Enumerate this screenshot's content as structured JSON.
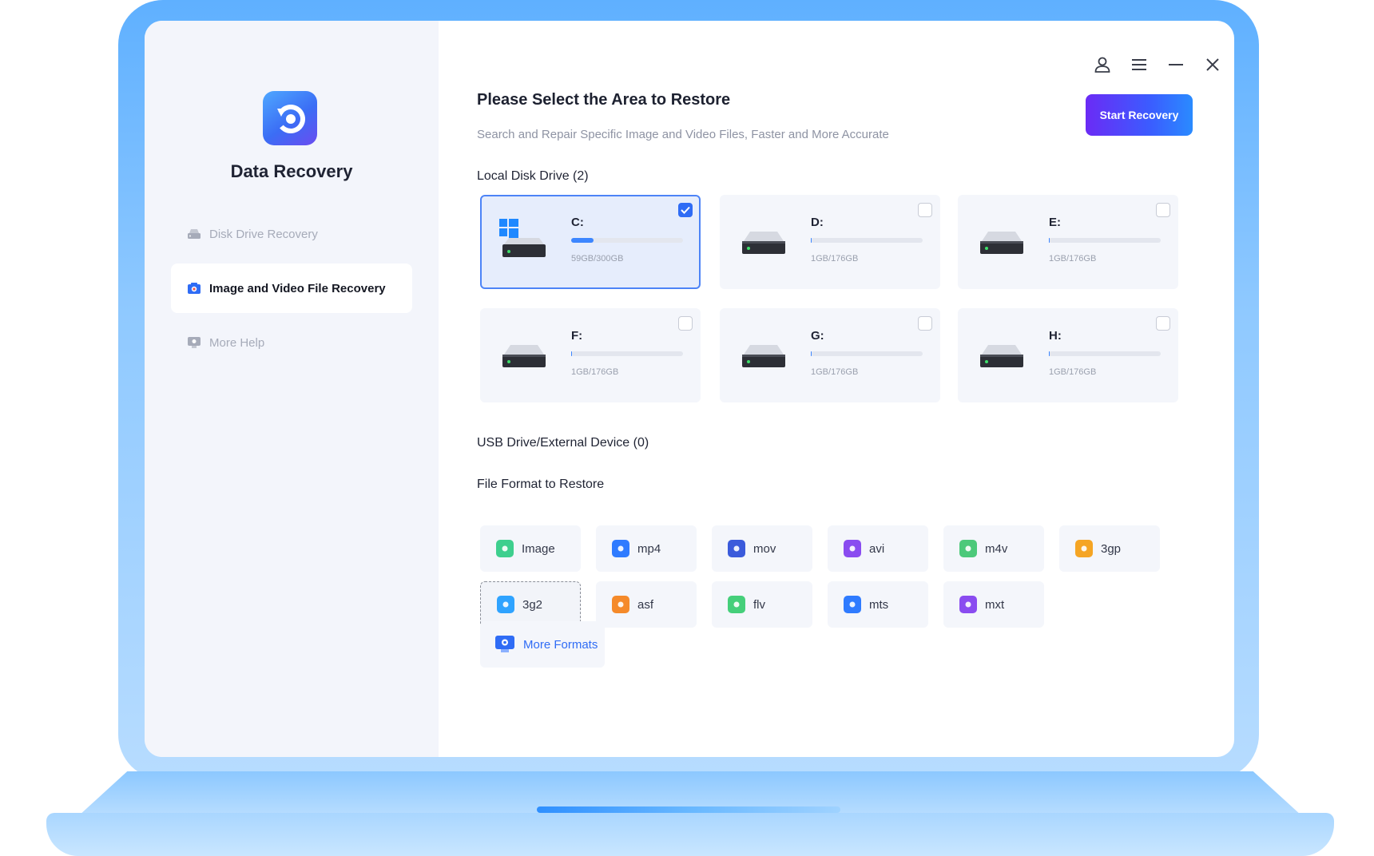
{
  "app": {
    "name": "Data Recovery"
  },
  "sidebar": {
    "items": [
      {
        "label": "Disk Drive Recovery",
        "icon": "hard-drive-icon",
        "active": false
      },
      {
        "label": "Image and Video File Recovery",
        "icon": "camera-icon",
        "active": true
      },
      {
        "label": "More Help",
        "icon": "help-icon",
        "active": false
      }
    ]
  },
  "header": {
    "title": "Please Select the Area to Restore",
    "subtitle": "Search and Repair Specific Image and Video Files, Faster and More Accurate",
    "start_label": "Start Recovery"
  },
  "sections": {
    "local": "Local Disk Drive (2)",
    "usb": "USB Drive/External Device (0)",
    "formats": "File Format to Restore"
  },
  "drives": [
    {
      "letter": "C:",
      "size": "59GB/300GB",
      "usage": 0.2,
      "checked": true,
      "windows": true
    },
    {
      "letter": "D:",
      "size": "1GB/176GB",
      "usage": 0.006,
      "checked": false
    },
    {
      "letter": "E:",
      "size": "1GB/176GB",
      "usage": 0.006,
      "checked": false
    },
    {
      "letter": "F:",
      "size": "1GB/176GB",
      "usage": 0.006,
      "checked": false
    },
    {
      "letter": "G:",
      "size": "1GB/176GB",
      "usage": 0.006,
      "checked": false
    },
    {
      "letter": "H:",
      "size": "1GB/176GB",
      "usage": 0.006,
      "checked": false
    }
  ],
  "formats": [
    {
      "label": "Image",
      "color": "#3ecf8e"
    },
    {
      "label": "mp4",
      "color": "#2f7bff"
    },
    {
      "label": "mov",
      "color": "#3b5bdb"
    },
    {
      "label": "avi",
      "color": "#8a4cf0"
    },
    {
      "label": "m4v",
      "color": "#4cc97a"
    },
    {
      "label": "3gp",
      "color": "#f5a524"
    },
    {
      "label": "3g2",
      "color": "#2fa3ff"
    },
    {
      "label": "asf",
      "color": "#f58a2a"
    },
    {
      "label": "flv",
      "color": "#45cf7a"
    },
    {
      "label": "mts",
      "color": "#2f7bff"
    },
    {
      "label": "mxt",
      "color": "#8a4cf0"
    }
  ],
  "more_formats": "More Formats",
  "colors": {
    "accent": "#2f6cf5",
    "button_start": "#6b2bf5",
    "button_end": "#2a8bff",
    "frame": "#8fc9ff"
  }
}
